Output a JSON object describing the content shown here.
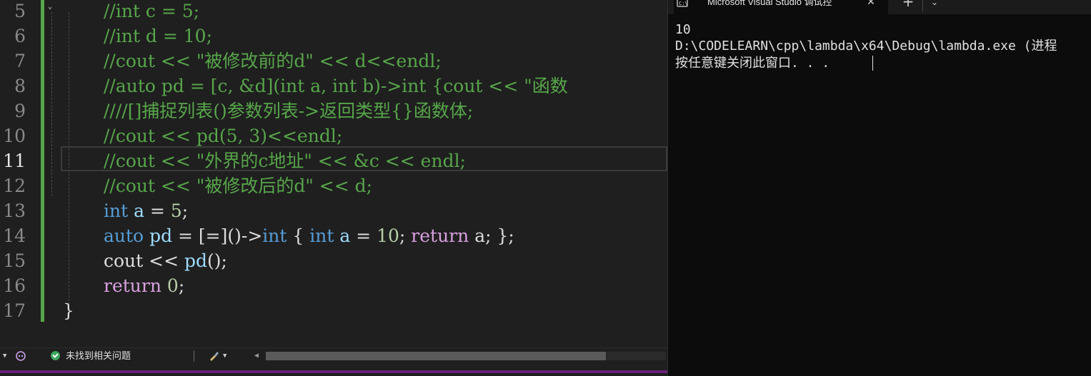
{
  "editor": {
    "lines": [
      {
        "number": "5",
        "tokens": [
          {
            "t": "//int c = 5;",
            "c": "c-com"
          }
        ]
      },
      {
        "number": "6",
        "tokens": [
          {
            "t": "//int d = 10;",
            "c": "c-com"
          }
        ]
      },
      {
        "number": "7",
        "tokens": [
          {
            "t": "//cout << \"被修改前的d\" << d<<endl;",
            "c": "c-com"
          }
        ]
      },
      {
        "number": "8",
        "tokens": [
          {
            "t": "//auto pd = [c, &d](int a, int b)->int {cout << \"函数",
            "c": "c-com"
          }
        ]
      },
      {
        "number": "9",
        "tokens": [
          {
            "t": "////[]捕捉列表()参数列表->返回类型{}函数体;",
            "c": "c-com"
          }
        ]
      },
      {
        "number": "10",
        "tokens": [
          {
            "t": "//cout << pd(5, 3)<<endl;",
            "c": "c-com"
          }
        ]
      },
      {
        "number": "11",
        "tokens": [
          {
            "t": "//cout << \"外界的c地址\" << &c << endl;",
            "c": "c-com"
          }
        ],
        "active": true
      },
      {
        "number": "12",
        "tokens": [
          {
            "t": "//cout << \"被修改后的d\" << d;",
            "c": "c-com"
          }
        ]
      },
      {
        "number": "13",
        "tokens": [
          {
            "t": "int",
            "c": "c-kw"
          },
          {
            "t": " ",
            "c": "c-txt"
          },
          {
            "t": "a",
            "c": "c-var"
          },
          {
            "t": " = ",
            "c": "c-txt"
          },
          {
            "t": "5",
            "c": "c-num"
          },
          {
            "t": ";",
            "c": "c-txt"
          }
        ]
      },
      {
        "number": "14",
        "tokens": [
          {
            "t": "auto",
            "c": "c-kw"
          },
          {
            "t": " ",
            "c": "c-txt"
          },
          {
            "t": "pd",
            "c": "c-var"
          },
          {
            "t": " = [=]()->",
            "c": "c-txt"
          },
          {
            "t": "int",
            "c": "c-kw"
          },
          {
            "t": " { ",
            "c": "c-txt"
          },
          {
            "t": "int",
            "c": "c-kw"
          },
          {
            "t": " ",
            "c": "c-txt"
          },
          {
            "t": "a",
            "c": "c-var"
          },
          {
            "t": " = ",
            "c": "c-txt"
          },
          {
            "t": "10",
            "c": "c-num"
          },
          {
            "t": "; ",
            "c": "c-txt"
          },
          {
            "t": "return",
            "c": "c-ret"
          },
          {
            "t": " a; };",
            "c": "c-txt"
          }
        ]
      },
      {
        "number": "15",
        "tokens": [
          {
            "t": "cout",
            "c": "c-txt"
          },
          {
            "t": " << ",
            "c": "c-txt"
          },
          {
            "t": "pd",
            "c": "c-var"
          },
          {
            "t": "();",
            "c": "c-txt"
          }
        ]
      },
      {
        "number": "16",
        "tokens": [
          {
            "t": "return",
            "c": "c-ret"
          },
          {
            "t": " ",
            "c": "c-txt"
          },
          {
            "t": "0",
            "c": "c-num"
          },
          {
            "t": ";",
            "c": "c-txt"
          }
        ]
      },
      {
        "number": "17",
        "tokens": [
          {
            "t": "}",
            "c": "c-txt"
          }
        ]
      }
    ]
  },
  "status": {
    "issues_label": "未找到相关问题",
    "icons": [
      "copilot-icon",
      "check-circle-icon",
      "brush-icon"
    ],
    "horizontal_scroll_fraction": 0.85
  },
  "console": {
    "tab_title": "Microsoft Visual Studio 调试控",
    "new_tab_symbol": "+",
    "output": [
      "10",
      "D:\\CODELEARN\\cpp\\lambda\\x64\\Debug\\lambda.exe (进程",
      "按任意键关闭此窗口. . ."
    ]
  },
  "colors": {
    "editor_bg": "#1f1f1f",
    "console_bg": "#0c0c0c",
    "comment": "#57a64a",
    "keyword": "#569cd6",
    "control": "#d8a0df",
    "number": "#b5cea8",
    "variable": "#9cdcfe",
    "change_bar": "#57a64a",
    "accent": "#68217a"
  }
}
